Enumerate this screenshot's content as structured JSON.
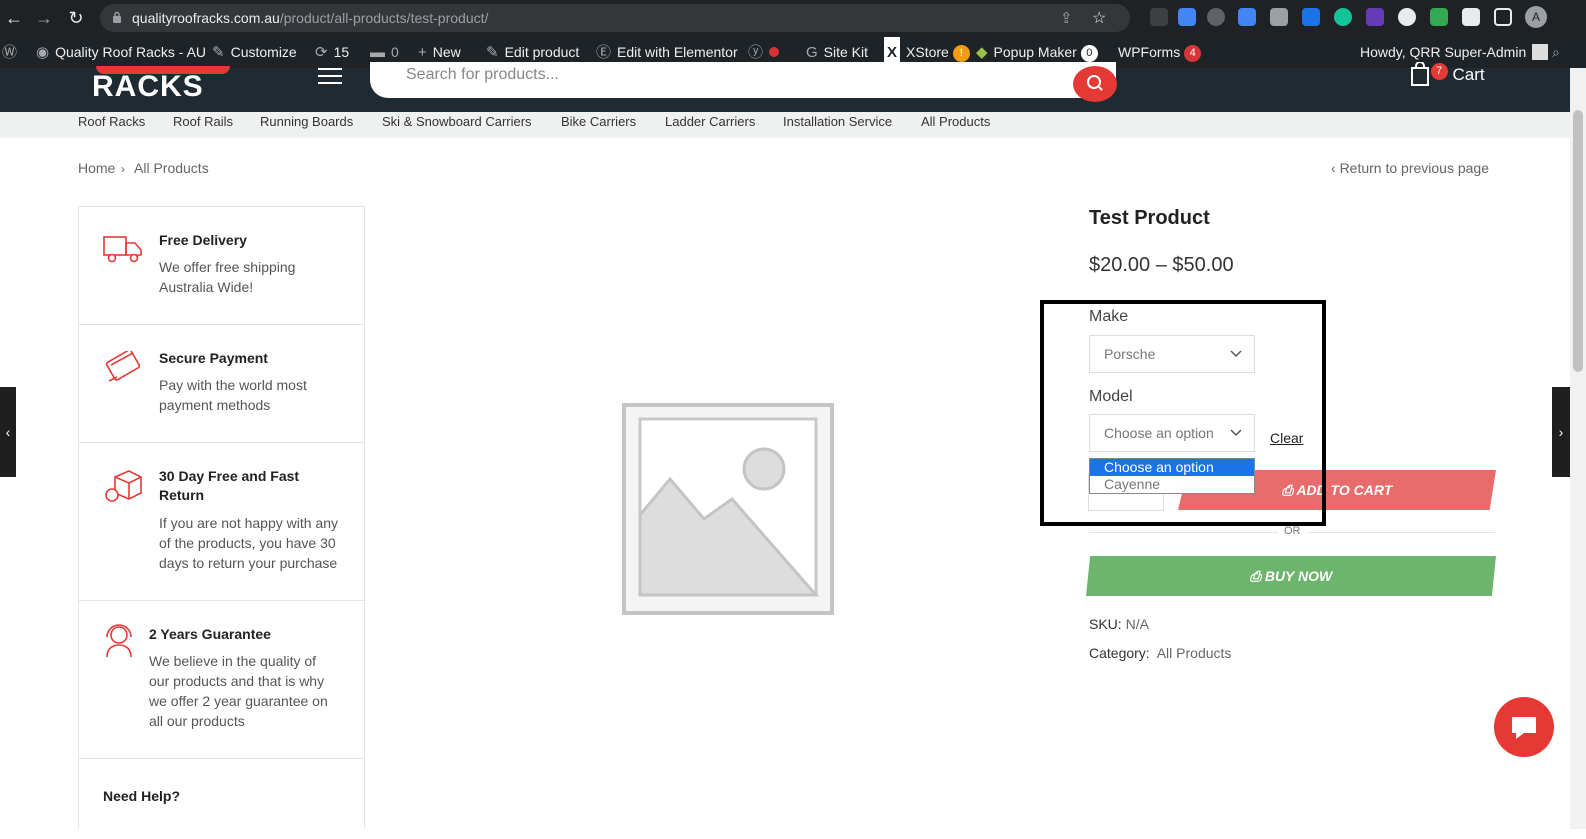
{
  "browser": {
    "url_domain": "qualityroofracks.com.au",
    "url_path": "/product/all-products/test-product/",
    "profile_initial": "A"
  },
  "adminbar": {
    "site_name": "Quality Roof Racks - AU",
    "customize": "Customize",
    "updates_count": "15",
    "comments_count": "0",
    "new": "New",
    "edit_product": "Edit product",
    "edit_elementor": "Edit with Elementor",
    "site_kit": "Site Kit",
    "xstore": "XStore",
    "xstore_badge": "!",
    "popup_maker": "Popup Maker",
    "popup_badge": "0",
    "wpforms": "WPForms",
    "wpforms_badge": "4",
    "howdy": "Howdy, QRR Super-Admin"
  },
  "header": {
    "logo_text": "RACKS",
    "search_placeholder": "Search for products...",
    "cart_label": "Cart",
    "cart_count": "7"
  },
  "categories": [
    "Roof Racks",
    "Roof Rails",
    "Running Boards",
    "Ski & Snowboard Carriers",
    "Bike Carriers",
    "Ladder Carriers",
    "Installation Service",
    "All Products"
  ],
  "breadcrumb": {
    "home": "Home",
    "sep": "›",
    "current": "All Products",
    "return": "Return to previous page"
  },
  "features": [
    {
      "title": "Free Delivery",
      "text": "We offer free shipping Australia Wide!"
    },
    {
      "title": "Secure Payment",
      "text": "Pay with the world most payment methods"
    },
    {
      "title": "30 Day Free and Fast Return",
      "text": "If you are not happy with any of the products, you have 30 days to return your purchase"
    },
    {
      "title": "2 Years Guarantee",
      "text": "We believe in the quality of our products and that is why we offer 2 year guarantee on all our products"
    },
    {
      "title": "Need Help?",
      "text": ""
    }
  ],
  "product": {
    "title": "Test Product",
    "price": "$20.00 – $50.00",
    "make_label": "Make",
    "make_value": "Porsche",
    "model_label": "Model",
    "model_value": "Choose an option",
    "clear": "Clear",
    "model_options": [
      "Choose an option",
      "Cayenne"
    ],
    "add_to_cart": "ADD TO CART",
    "or": "OR",
    "buy_now": "BUY NOW",
    "sku_label": "SKU:",
    "sku_value": "N/A",
    "category_label": "Category:",
    "category_value": "All Products"
  },
  "colors": {
    "brand_red": "#e53935",
    "add_to_cart_bg": "#e96c6c",
    "buy_now_bg": "#6db46d",
    "header_bg": "#1f2a33"
  }
}
